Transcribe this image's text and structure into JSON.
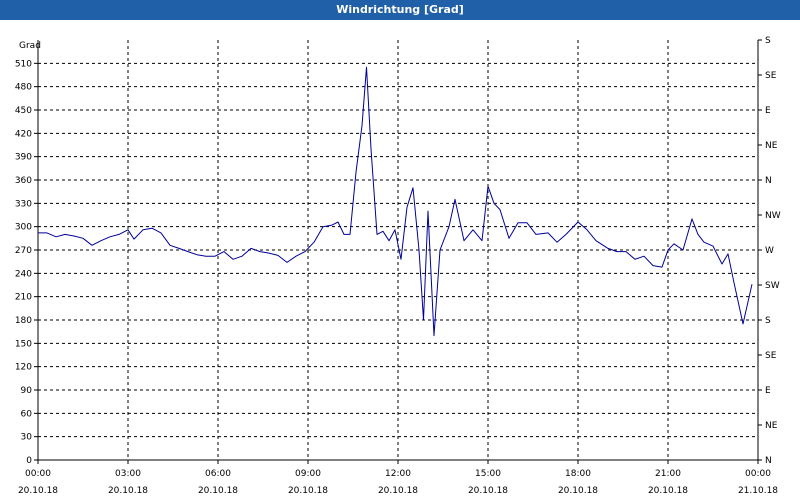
{
  "window": {
    "title": "Windrichtung [Grad]"
  },
  "colors": {
    "title_bar": "#2060a8",
    "series_line": "#000099",
    "grid": "#000000"
  },
  "chart_data": {
    "type": "line",
    "title": "Windrichtung [Grad]",
    "ylabel": "Grad",
    "ylim": [
      0,
      540
    ],
    "yticks": [
      0,
      30,
      60,
      90,
      120,
      150,
      180,
      210,
      240,
      270,
      300,
      330,
      360,
      390,
      420,
      450,
      480,
      510
    ],
    "y2ticks": [
      {
        "value": 0,
        "label": "N"
      },
      {
        "value": 45,
        "label": "NE"
      },
      {
        "value": 90,
        "label": "E"
      },
      {
        "value": 135,
        "label": "SE"
      },
      {
        "value": 180,
        "label": "S"
      },
      {
        "value": 225,
        "label": "SW"
      },
      {
        "value": 270,
        "label": "W"
      },
      {
        "value": 315,
        "label": "NW"
      },
      {
        "value": 360,
        "label": "N"
      },
      {
        "value": 405,
        "label": "NE"
      },
      {
        "value": 450,
        "label": "E"
      },
      {
        "value": 495,
        "label": "SE"
      },
      {
        "value": 540,
        "label": "S"
      }
    ],
    "xlim": [
      0,
      24
    ],
    "xticks": [
      {
        "hour": 0,
        "time": "00:00",
        "date": "20.10.18"
      },
      {
        "hour": 3,
        "time": "03:00",
        "date": "20.10.18"
      },
      {
        "hour": 6,
        "time": "06:00",
        "date": "20.10.18"
      },
      {
        "hour": 9,
        "time": "09:00",
        "date": "20.10.18"
      },
      {
        "hour": 12,
        "time": "12:00",
        "date": "20.10.18"
      },
      {
        "hour": 15,
        "time": "15:00",
        "date": "20.10.18"
      },
      {
        "hour": 18,
        "time": "18:00",
        "date": "20.10.18"
      },
      {
        "hour": 21,
        "time": "21:00",
        "date": "20.10.18"
      },
      {
        "hour": 24,
        "time": "00:00",
        "date": "21.10.18"
      }
    ],
    "grid": true,
    "series": [
      {
        "x": [
          0,
          0.3,
          0.6,
          0.9,
          1.2,
          1.5,
          1.8,
          2.1,
          2.4,
          2.7,
          3.0,
          3.2,
          3.5,
          3.8,
          4.1,
          4.4,
          4.7,
          5.0,
          5.3,
          5.6,
          5.9,
          6.2,
          6.5,
          6.8,
          7.1,
          7.4,
          7.7,
          8.0,
          8.3,
          8.6,
          8.9,
          9.2,
          9.5,
          9.8,
          10.0,
          10.2,
          10.4,
          10.6,
          10.8,
          10.95,
          11.1,
          11.3,
          11.5,
          11.7,
          11.9,
          12.1,
          12.3,
          12.5,
          12.7,
          12.85,
          13.0,
          13.2,
          13.4,
          13.7,
          13.9,
          14.2,
          14.5,
          14.8,
          15.0,
          15.2,
          15.4,
          15.7,
          16.0,
          16.3,
          16.6,
          17.0,
          17.3,
          17.6,
          18.0,
          18.3,
          18.6,
          19.0,
          19.3,
          19.6,
          19.9,
          20.2,
          20.5,
          20.8,
          21.0,
          21.2,
          21.5,
          21.8,
          22.0,
          22.2,
          22.5,
          22.8,
          23.0,
          23.2,
          23.5,
          23.8
        ],
        "y": [
          292,
          292,
          287,
          290,
          288,
          285,
          276,
          282,
          287,
          290,
          296,
          284,
          296,
          298,
          292,
          276,
          272,
          268,
          264,
          262,
          262,
          268,
          258,
          262,
          272,
          268,
          266,
          263,
          254,
          262,
          268,
          280,
          300,
          302,
          306,
          290,
          290,
          370,
          430,
          505,
          400,
          290,
          294,
          282,
          296,
          258,
          325,
          350,
          270,
          180,
          320,
          160,
          270,
          300,
          335,
          282,
          296,
          282,
          352,
          330,
          322,
          285,
          305,
          305,
          290,
          292,
          280,
          290,
          306,
          296,
          282,
          272,
          268,
          268,
          258,
          262,
          250,
          248,
          270,
          278,
          270,
          310,
          290,
          280,
          275,
          252,
          265,
          228,
          175,
          226
        ]
      }
    ]
  }
}
